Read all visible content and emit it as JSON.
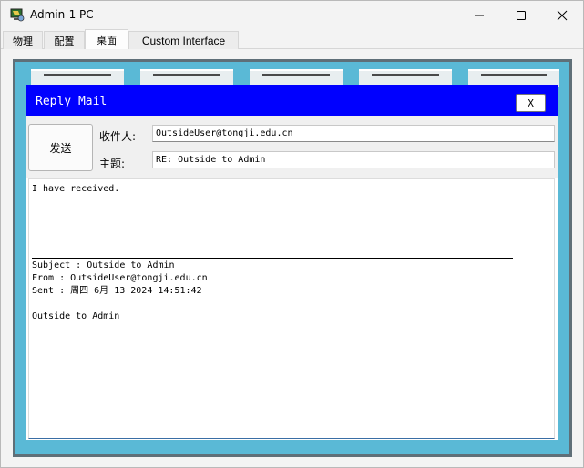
{
  "window": {
    "title": "Admin-1 PC"
  },
  "tabs": [
    {
      "label": "物理"
    },
    {
      "label": "配置"
    },
    {
      "label": "桌面"
    },
    {
      "label": "Custom Interface"
    }
  ],
  "mail": {
    "title": "Reply Mail",
    "close_label": "X",
    "send_label": "发送",
    "to_label": "收件人:",
    "to_value": "OutsideUser@tongji.edu.cn",
    "subject_label": "主题:",
    "subject_value": "RE: Outside to Admin",
    "body": {
      "reply_text": "I have received.",
      "quoted_subject": "Subject : Outside to Admin",
      "quoted_from": "From : OutsideUser@tongji.edu.cn",
      "quoted_sent": "Sent : 周四 6月 13 2024 14:51:42",
      "quoted_body": "Outside to Admin"
    }
  },
  "icons": {
    "app": "packet-tracer-pc-icon",
    "minimize": "minimize-icon",
    "maximize": "maximize-icon",
    "close": "close-icon"
  },
  "colors": {
    "mail_title_bar": "#0000ff",
    "desktop_background": "#5ab9d6"
  }
}
